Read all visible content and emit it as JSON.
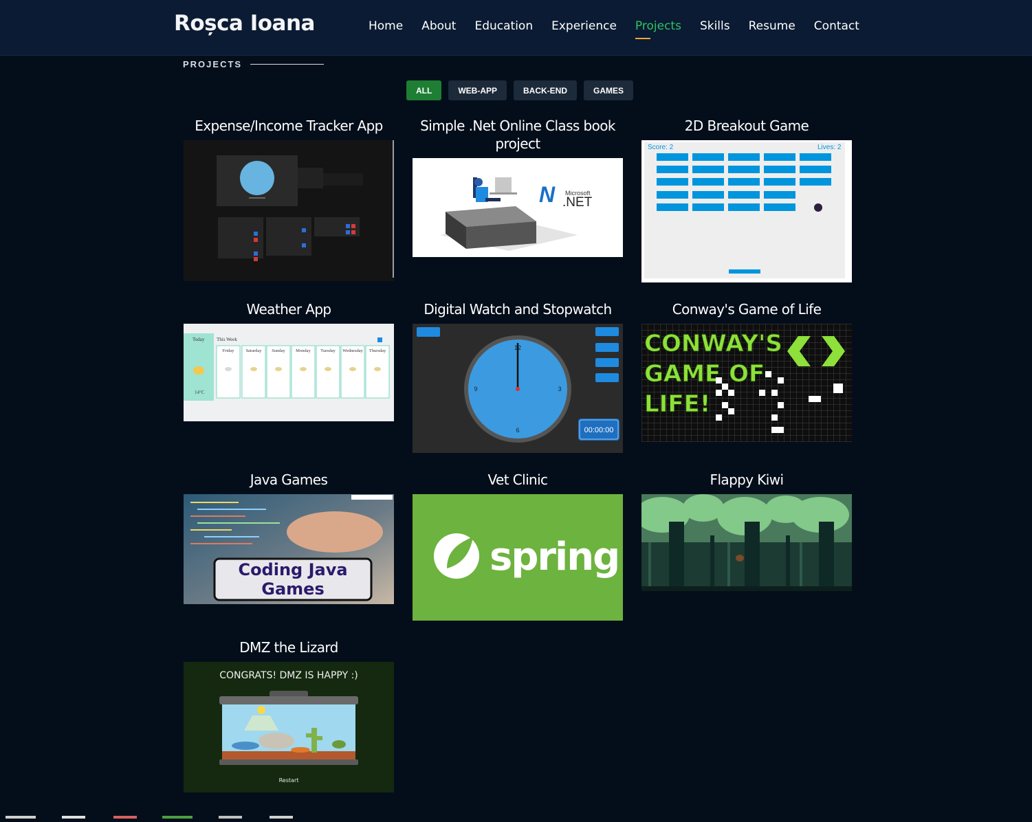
{
  "brand": "Roșca Ioana",
  "nav": [
    "Home",
    "About",
    "Education",
    "Experience",
    "Projects",
    "Skills",
    "Resume",
    "Contact"
  ],
  "section_title": "PROJECTS",
  "filters": [
    "ALL",
    "WEB-APP",
    "BACK-END",
    "GAMES"
  ],
  "projects": [
    {
      "title": "Expense/Income Tracker App"
    },
    {
      "title": "Simple .Net Online Class book project"
    },
    {
      "title": "2D Breakout Game"
    },
    {
      "title": "Weather App"
    },
    {
      "title": "Digital Watch and Stopwatch"
    },
    {
      "title": "Conway's Game of Life"
    },
    {
      "title": "Java Games"
    },
    {
      "title": "Vet Clinic"
    },
    {
      "title": "Flappy Kiwi"
    },
    {
      "title": "DMZ the Lizard"
    }
  ],
  "thumbs": {
    "breakout": {
      "score": "Score: 2",
      "lives": "Lives: 2"
    },
    "net": {
      "brand_small": "Microsoft",
      "brand_big": ".NET"
    },
    "weather": {
      "today": "Today",
      "week": "This Week",
      "days": [
        "Friday",
        "Saturday",
        "Sunday",
        "Monday",
        "Tuesday",
        "Wednesday",
        "Thursday"
      ],
      "temp": "14°C"
    },
    "watch": {
      "time": "00:00:00",
      "n12": "12",
      "n3": "3",
      "n6": "6",
      "n9": "9"
    },
    "conway": {
      "line1": "CONWAY'S",
      "line2": "GAME OF",
      "line3": "LIFE!"
    },
    "java": {
      "line1": "Coding Java",
      "line2": "Games"
    },
    "spring": {
      "word": "spring"
    },
    "dmz": {
      "msg": "CONGRATS! DMZ IS HAPPY :)",
      "restart": "Restart"
    }
  },
  "colors": {
    "accent_green": "#2ec262",
    "nav_underline": "#f0a83a",
    "filter_active": "#1e7e34",
    "bg": "#040e1a",
    "header": "#0b1b33"
  }
}
